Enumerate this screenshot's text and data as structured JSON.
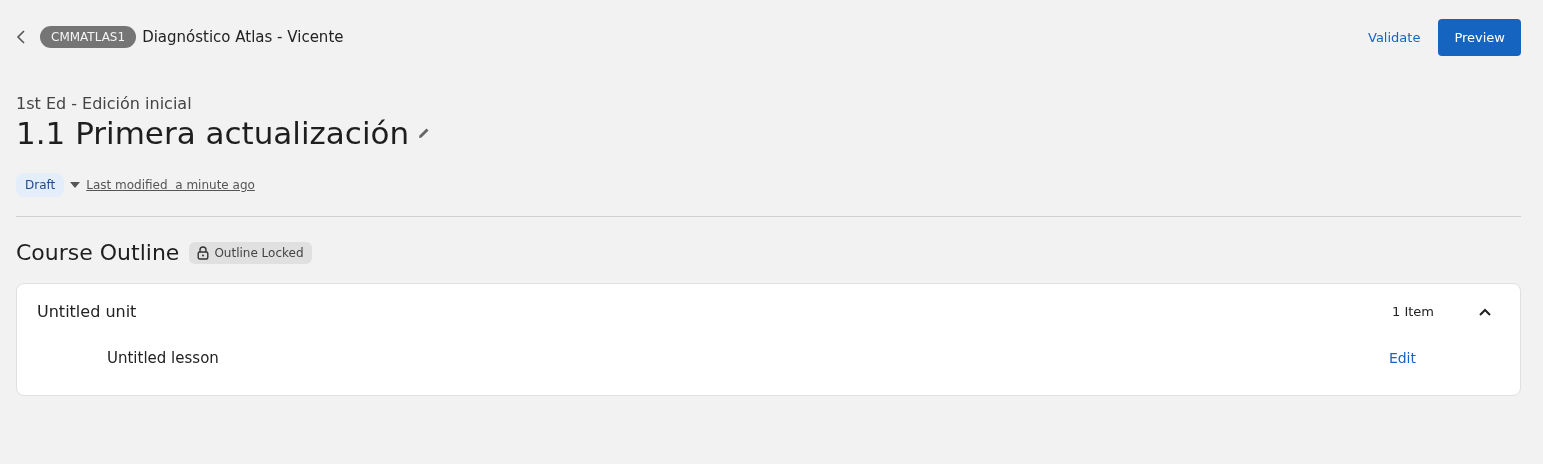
{
  "header": {
    "course_code": "CMMATLAS1",
    "course_name": "Diagnóstico Atlas - Vicente",
    "actions": [
      {
        "label": "Validate",
        "kind": "link"
      },
      {
        "label": "Preview",
        "kind": "primary"
      }
    ]
  },
  "edition": "1st Ed - Edición inicial",
  "title": "1.1 Primera actualización",
  "status": {
    "label": "Draft",
    "last_modified": "Last modified  a minute ago"
  },
  "outline": {
    "title": "Course Outline",
    "lock_label": "Outline Locked",
    "units": [
      {
        "name": "Untitled unit",
        "count": "1 Item",
        "expanded": true,
        "children": [
          {
            "name": "Untitled lesson",
            "action": "Edit"
          }
        ]
      }
    ]
  }
}
